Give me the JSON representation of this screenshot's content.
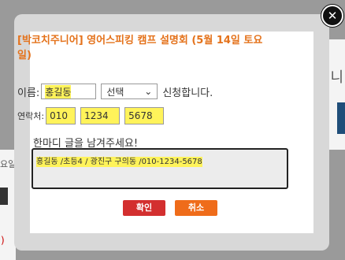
{
  "background": {
    "right_glyph": "니",
    "left_text": "요일",
    "left_mark": ")"
  },
  "modal": {
    "close_symbol": "✕",
    "title": "[박코치주니어] 영어스피킹 캠프 설명회 (5월 14일 토요일)",
    "name_label": "이름:",
    "name_value": "홍길동",
    "select_value": "선택",
    "select_arrow": "⌄",
    "apply_text": "신청합니다.",
    "phone_label": "연락처:",
    "phone": [
      "010",
      "1234",
      "5678"
    ],
    "comment_prompt": "한마디 글을 남겨주세요!",
    "comment_value": "홍길동 /초등4 / 광진구 구의동 /010-1234-5678",
    "confirm_label": "확인",
    "cancel_label": "취소"
  },
  "colors": {
    "title": "#e4721b",
    "highlight": "#fff35a",
    "confirm": "#d32f2f",
    "cancel": "#ef6c1a"
  }
}
